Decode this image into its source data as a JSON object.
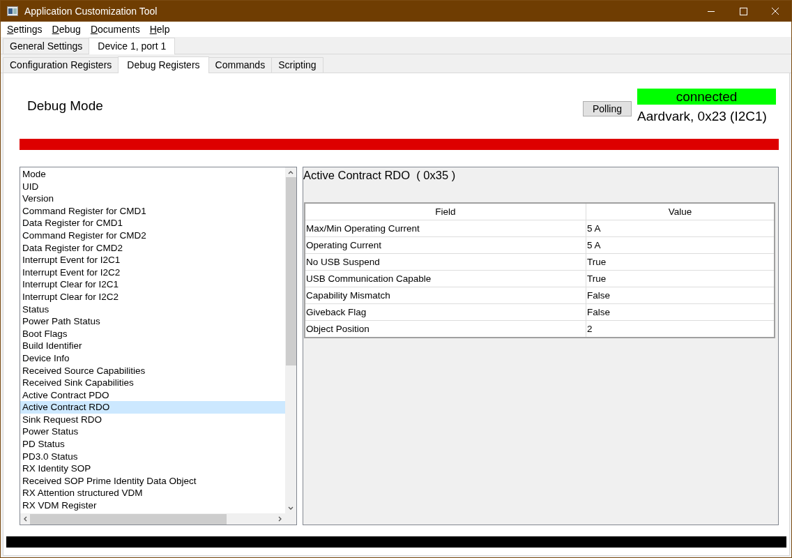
{
  "window": {
    "title": "Application Customization Tool"
  },
  "menu": [
    "Settings",
    "Debug",
    "Documents",
    "Help"
  ],
  "outer_tabs": [
    {
      "label": "General Settings",
      "selected": false
    },
    {
      "label": "Device 1, port 1",
      "selected": true
    }
  ],
  "inner_tabs": [
    {
      "label": "Configuration Registers",
      "selected": false
    },
    {
      "label": "Debug Registers",
      "selected": true
    },
    {
      "label": "Commands",
      "selected": false
    },
    {
      "label": "Scripting",
      "selected": false
    }
  ],
  "header": {
    "title": "Debug Mode",
    "polling_button": "Polling",
    "connection": {
      "status": "connected",
      "connected": true
    },
    "device": "Aardvark, 0x23 (I2C1)"
  },
  "registers": [
    {
      "label": "Mode",
      "selected": false
    },
    {
      "label": "UID",
      "selected": false
    },
    {
      "label": "Version",
      "selected": false
    },
    {
      "label": "Command Register for CMD1",
      "selected": false
    },
    {
      "label": "Data Register for CMD1",
      "selected": false
    },
    {
      "label": "Command Register for CMD2",
      "selected": false
    },
    {
      "label": "Data Register for CMD2",
      "selected": false
    },
    {
      "label": "Interrupt Event for I2C1",
      "selected": false
    },
    {
      "label": "Interrupt Event for I2C2",
      "selected": false
    },
    {
      "label": "Interrupt Clear for I2C1",
      "selected": false
    },
    {
      "label": "Interrupt Clear for I2C2",
      "selected": false
    },
    {
      "label": "Status",
      "selected": false
    },
    {
      "label": "Power Path Status",
      "selected": false
    },
    {
      "label": "Boot Flags",
      "selected": false
    },
    {
      "label": "Build Identifier",
      "selected": false
    },
    {
      "label": "Device Info",
      "selected": false
    },
    {
      "label": "Received Source Capabilities",
      "selected": false
    },
    {
      "label": "Received Sink Capabilities",
      "selected": false
    },
    {
      "label": "Active Contract PDO",
      "selected": false
    },
    {
      "label": "Active Contract RDO",
      "selected": true
    },
    {
      "label": "Sink Request RDO",
      "selected": false
    },
    {
      "label": "Power Status",
      "selected": false
    },
    {
      "label": "PD Status",
      "selected": false
    },
    {
      "label": "PD3.0 Status",
      "selected": false
    },
    {
      "label": "RX Identity SOP",
      "selected": false
    },
    {
      "label": "Received SOP Prime Identity Data Object",
      "selected": false
    },
    {
      "label": "RX Attention structured VDM",
      "selected": false
    },
    {
      "label": "RX VDM Register",
      "selected": false
    }
  ],
  "detail": {
    "title": "Active Contract RDO  ( 0x35 )",
    "columns": [
      "Field",
      "Value"
    ],
    "rows": [
      [
        "Max/Min Operating Current",
        "5 A"
      ],
      [
        "Operating Current",
        "5 A"
      ],
      [
        "No USB Suspend",
        "True"
      ],
      [
        "USB Communication Capable",
        "True"
      ],
      [
        "Capability Mismatch",
        "False"
      ],
      [
        "Giveback Flag",
        "False"
      ],
      [
        "Object Position",
        "2"
      ]
    ]
  }
}
